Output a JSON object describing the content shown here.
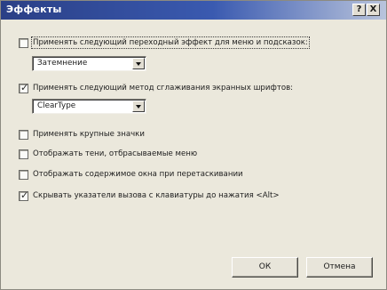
{
  "window": {
    "title": "Эффекты",
    "help_label": "?",
    "close_label": "X"
  },
  "options": [
    {
      "label": "Применять следующий переходный эффект для меню и подсказок:",
      "checked": false,
      "focused": true
    },
    {
      "label": "Применять следующий метод сглаживания экранных шрифтов:",
      "checked": true,
      "focused": false
    },
    {
      "label": "Применять крупные значки",
      "checked": false,
      "focused": false
    },
    {
      "label": "Отображать тени, отбрасываемые меню",
      "checked": false,
      "focused": false
    },
    {
      "label": "Отображать содержимое окна при перетаскивании",
      "checked": false,
      "focused": false
    },
    {
      "label": "Скрывать указатели вызова с клавиатуры до нажатия <Alt>",
      "checked": true,
      "focused": false
    }
  ],
  "transition_effect": {
    "value": "Затемнение"
  },
  "smoothing_method": {
    "value": "ClearType"
  },
  "buttons": {
    "ok_label": "ОК",
    "cancel_label": "Отмена"
  }
}
